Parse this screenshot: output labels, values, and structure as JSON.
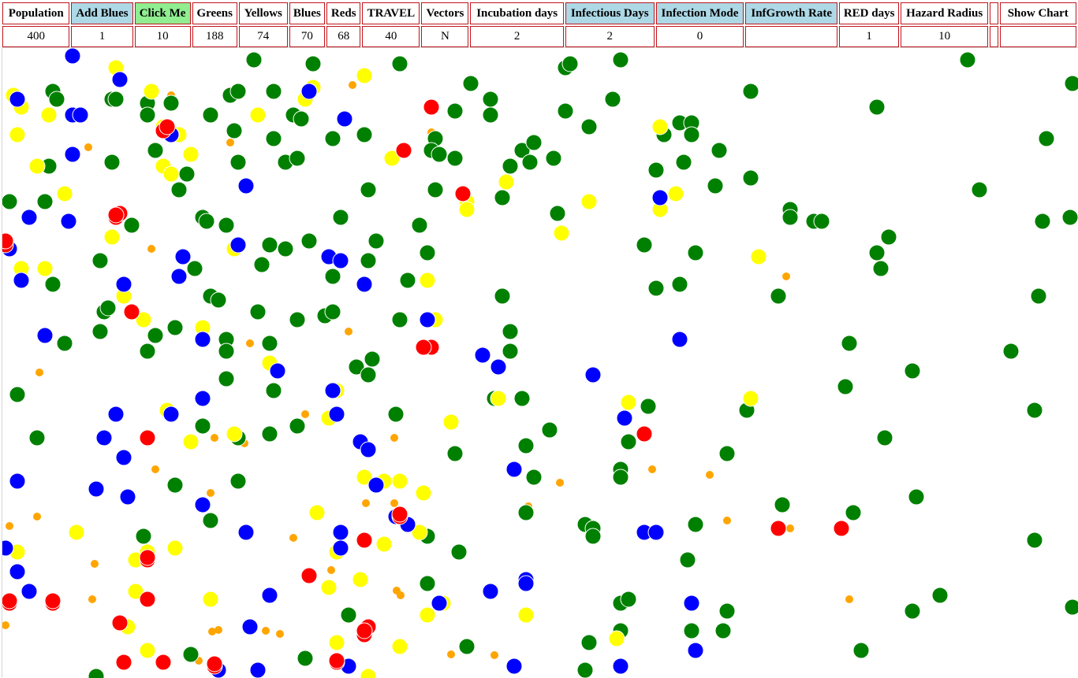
{
  "headers": {
    "population": "Population",
    "add_blues": "Add Blues",
    "click_me": "Click Me",
    "greens": "Greens",
    "yellows": "Yellows",
    "blues": "Blues",
    "reds": "Reds",
    "travel": "TRAVEL",
    "vectors": "Vectors",
    "incubation_days": "Incubation days",
    "infectious_days": "Infectious Days",
    "infection_mode": "Infection Mode",
    "inf_growth_rate": "InfGrowth Rate",
    "red_days": "RED days",
    "hazard_radius": "Hazard Radius",
    "show_chart": "Show Chart"
  },
  "values": {
    "population": "400",
    "add_blues": "1",
    "click_me": "10",
    "greens": "188",
    "yellows": "74",
    "blues": "70",
    "reds": "68",
    "travel": "40",
    "vectors": "N",
    "incubation_days": "2",
    "infectious_days": "2",
    "infection_mode": "0",
    "inf_growth_rate": "",
    "red_days": "1",
    "hazard_radius": "10",
    "show_chart": ""
  },
  "colors": {
    "green": "#008000",
    "yellow": "#ffff00",
    "blue": "#0000ff",
    "red": "#ff0000",
    "orange": "#ffa500",
    "border": "#c0141b",
    "header_blue": "#add8e6",
    "header_green": "#90ee90"
  }
}
